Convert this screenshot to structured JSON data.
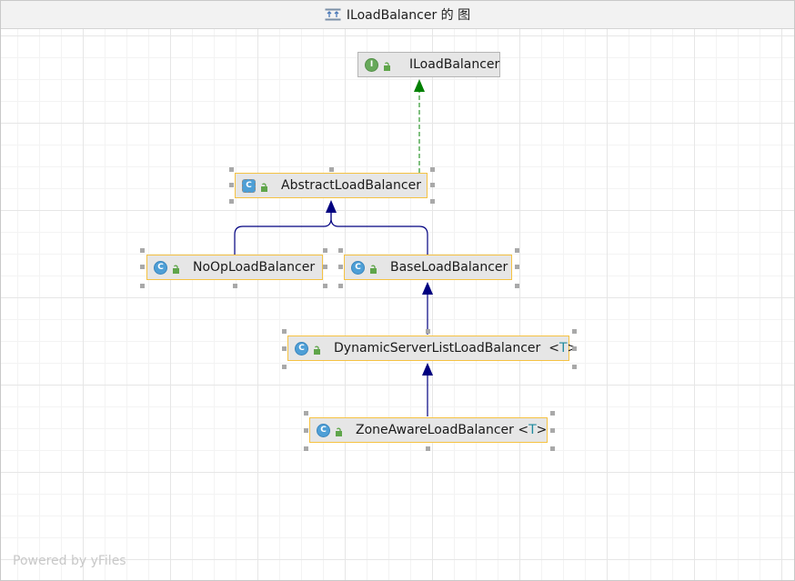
{
  "window": {
    "title": "ILoadBalancer 的 图"
  },
  "nodes": {
    "iloadbalancer": {
      "name": "ILoadBalancer",
      "kind_letter": "I"
    },
    "abstractloadbalancer": {
      "name": "AbstractLoadBalancer",
      "kind_letter": "C"
    },
    "noop": {
      "name": "NoOpLoadBalancer",
      "kind_letter": "C"
    },
    "base": {
      "name": "BaseLoadBalancer",
      "kind_letter": "C"
    },
    "dynamic": {
      "name": "DynamicServerListLoadBalancer",
      "tparam_open": "<",
      "tparam": "T",
      "tparam_close": ">",
      "kind_letter": "C"
    },
    "zone": {
      "name": "ZoneAwareLoadBalancer",
      "tparam_open": "<",
      "tparam": "T",
      "tparam_close": ">",
      "kind_letter": "C"
    }
  },
  "footer": {
    "text": "Powered by yFiles"
  },
  "colors": {
    "extends_edge": "#000080",
    "implements_edge": "#008000",
    "node_border_selected": "#f5c242",
    "class_icon": "#4e9fd6",
    "interface_icon": "#67a95a"
  }
}
